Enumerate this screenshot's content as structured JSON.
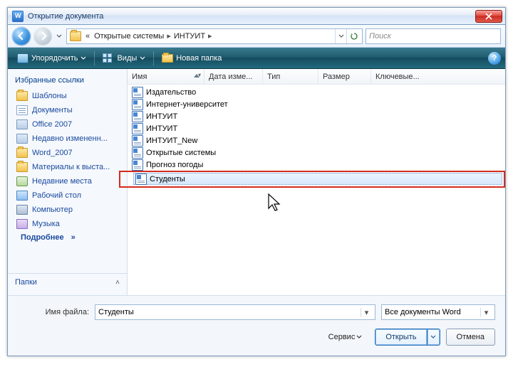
{
  "title": "Открытие документа",
  "breadcrumb": {
    "seg1": "Открытые системы",
    "seg2": "ИНТУИТ"
  },
  "search_placeholder": "Поиск",
  "cmdbar": {
    "organize": "Упорядочить",
    "views": "Виды",
    "newfolder": "Новая папка"
  },
  "sidebar": {
    "header": "Избранные ссылки",
    "items": [
      {
        "label": "Шаблоны",
        "icon": "folder"
      },
      {
        "label": "Документы",
        "icon": "doc"
      },
      {
        "label": "Office 2007",
        "icon": "search"
      },
      {
        "label": "Недавно измененн...",
        "icon": "search"
      },
      {
        "label": "Word_2007",
        "icon": "folder"
      },
      {
        "label": "Материалы к выста...",
        "icon": "folder"
      },
      {
        "label": "Недавние места",
        "icon": "recent"
      },
      {
        "label": "Рабочий стол",
        "icon": "desktop"
      },
      {
        "label": "Компьютер",
        "icon": "computer"
      },
      {
        "label": "Музыка",
        "icon": "music"
      }
    ],
    "more": "Подробнее",
    "folders": "Папки"
  },
  "columns": {
    "name": "Имя",
    "date": "Дата изме...",
    "type": "Тип",
    "size": "Размер",
    "key": "Ключевые..."
  },
  "files": [
    "Издательство",
    "Интернет-университет",
    "ИНТУИТ",
    "ИНТУИТ",
    "ИНТУИТ_New",
    "Открытые системы",
    "Прогноз погоды"
  ],
  "selected_file": "Студенты",
  "footer": {
    "filename_label": "Имя файла:",
    "filename_value": "Студенты",
    "filter": "Все документы Word",
    "tools": "Сервис",
    "open": "Открыть",
    "cancel": "Отмена"
  }
}
